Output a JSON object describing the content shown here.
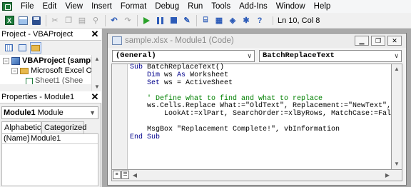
{
  "menubar": {
    "items": [
      {
        "label": "File"
      },
      {
        "label": "Edit"
      },
      {
        "label": "View"
      },
      {
        "label": "Insert"
      },
      {
        "label": "Format"
      },
      {
        "label": "Debug"
      },
      {
        "label": "Run"
      },
      {
        "label": "Tools"
      },
      {
        "label": "Add-Ins"
      },
      {
        "label": "Window"
      },
      {
        "label": "Help"
      }
    ]
  },
  "toolbar": {
    "position_readout": "Ln 10, Col 8"
  },
  "project_explorer": {
    "title": "Project - VBAProject",
    "tree": [
      {
        "label": "VBAProject (sampl"
      },
      {
        "label": "Microsoft Excel Ol"
      },
      {
        "label": "Sheet1 (Shee"
      }
    ]
  },
  "properties": {
    "title": "Properties - Module1",
    "object_name": "Module1",
    "object_type": "Module",
    "tabs": {
      "alphabetic": "Alphabetic",
      "categorized": "Categorized"
    },
    "rows": [
      {
        "name": "(Name)",
        "value": "Module1"
      }
    ]
  },
  "code_window": {
    "title": "sample.xlsx - Module1 (Code)",
    "object_combo": "(General)",
    "procedure_combo": "BatchReplaceText",
    "code_lines": [
      "Sub BatchReplaceText()",
      "    Dim ws As Worksheet",
      "    Set ws = ActiveSheet",
      "",
      "    ' Define what to find and what to replace",
      "    ws.Cells.Replace What:=\"OldText\", Replacement:=\"NewText\", _",
      "        LookAt:=xlPart, SearchOrder:=xlByRows, MatchCase:=False",
      "",
      "    MsgBox \"Replacement Complete!\", vbInformation",
      "End Sub"
    ]
  }
}
